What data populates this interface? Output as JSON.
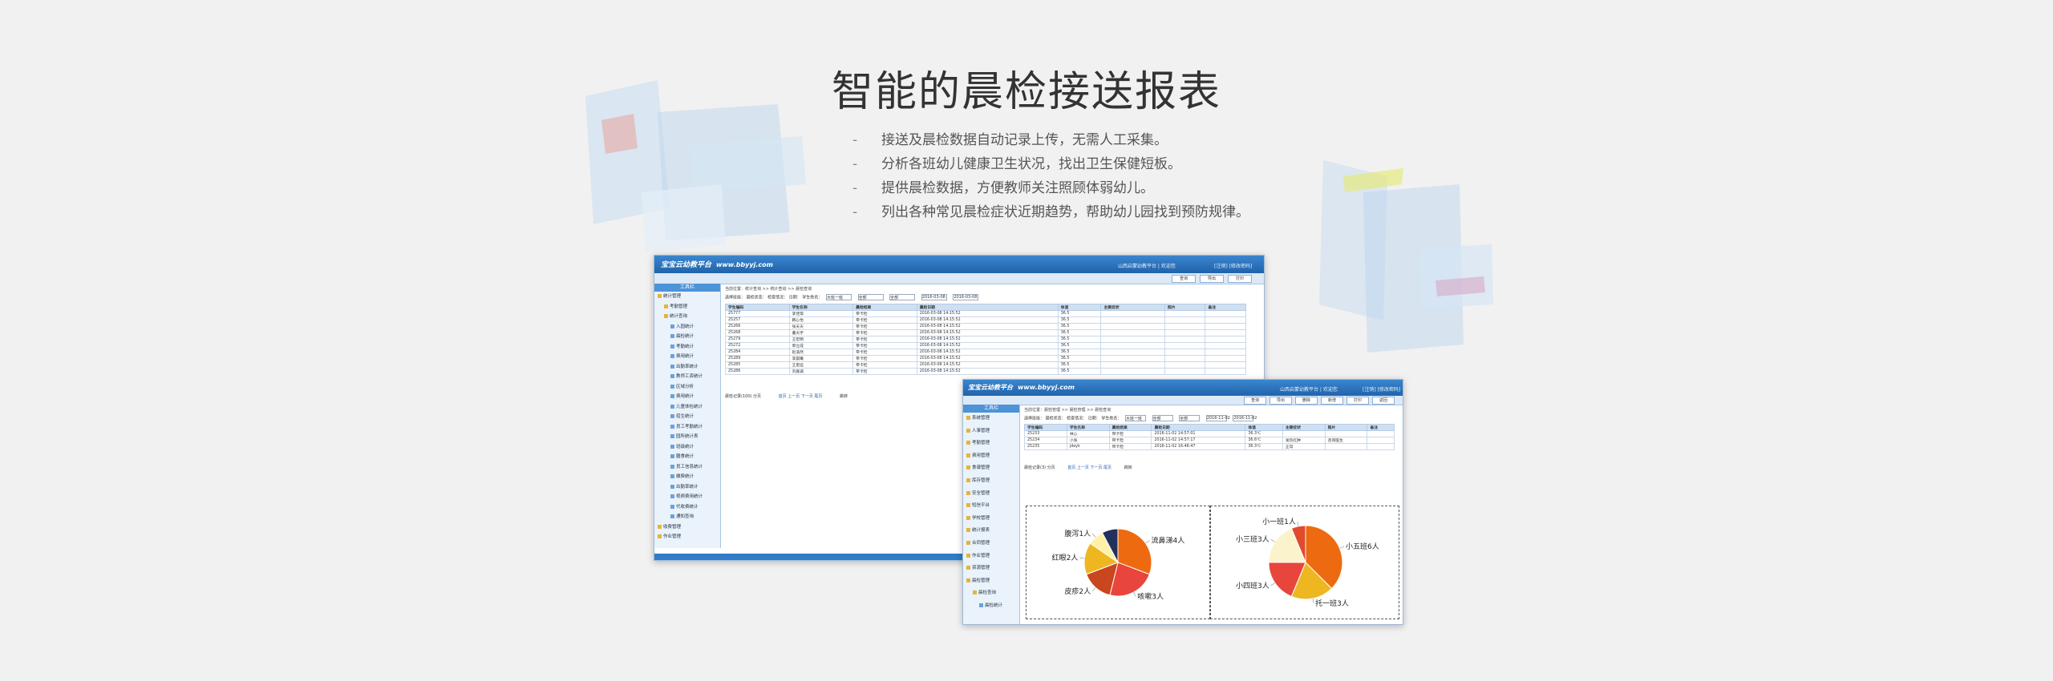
{
  "heading": "智能的晨检接送报表",
  "bullets": [
    "接送及晨检数据自动记录上传，无需人工采集。",
    "分析各班幼儿健康卫生状况，找出卫生保健短板。",
    "提供晨检数据，方便教师关注照顾体弱幼儿。",
    "列出各种常见晨检症状近期趋势，帮助幼儿园找到预防规律。"
  ],
  "bullet_dash": "-",
  "win1": {
    "logo": "宝宝云幼教平台",
    "logo_url": "www.bbyyj.com",
    "header_info": "山西启蒙幼教平台 | 欢迎您",
    "header_links": "[注销] [修改密码]",
    "toolbar": [
      "查询",
      "导出",
      "打印"
    ],
    "sidebar_title": "工具栏",
    "sidebar": [
      {
        "label": "统计管理",
        "folder": true,
        "indent": 0
      },
      {
        "label": "考勤管理",
        "folder": true,
        "indent": 1
      },
      {
        "label": "统计查询",
        "folder": true,
        "indent": 1
      },
      {
        "label": "入园统计",
        "indent": 2
      },
      {
        "label": "晨检统计",
        "indent": 2
      },
      {
        "label": "考勤统计",
        "indent": 2
      },
      {
        "label": "费用统计",
        "indent": 2
      },
      {
        "label": "出勤率统计",
        "indent": 2
      },
      {
        "label": "教师工资统计",
        "indent": 2
      },
      {
        "label": "区域分析",
        "indent": 2
      },
      {
        "label": "费用统计",
        "indent": 2
      },
      {
        "label": "儿童体检统计",
        "indent": 2
      },
      {
        "label": "招生统计",
        "indent": 2
      },
      {
        "label": "员工考勤统计",
        "indent": 2
      },
      {
        "label": "园所统计表",
        "indent": 2
      },
      {
        "label": "班级统计",
        "indent": 2
      },
      {
        "label": "膳食统计",
        "indent": 2
      },
      {
        "label": "员工信息统计",
        "indent": 2
      },
      {
        "label": "缴费统计",
        "indent": 2
      },
      {
        "label": "出勤率统计",
        "indent": 2
      },
      {
        "label": "视频费用统计",
        "indent": 2
      },
      {
        "label": "代收费统计",
        "indent": 2
      },
      {
        "label": "通知查询",
        "indent": 2
      },
      {
        "label": "收费管理",
        "folder": true,
        "indent": 0
      },
      {
        "label": "作业管理",
        "folder": true,
        "indent": 0
      }
    ],
    "crumb": "当前位置：统计查询 >> 统计查询 >> 晨检查询",
    "filter_text": "选择班级：  晨检状态：  检查情况：  日期：  学生姓名：",
    "filter_values": [
      "大班一班",
      "全部",
      "全部",
      "2016-03-08",
      "2016-03-08"
    ],
    "columns": [
      "学生编码",
      "学生名称",
      "晨检结果",
      "晨检日期",
      "体温",
      "主要症状",
      "照片",
      "备注"
    ],
    "rows": [
      [
        "25777",
        "李佳琪",
        "带卡检",
        "2016-03-08 14:15:52",
        "36.5",
        "",
        "",
        ""
      ],
      [
        "25257",
        "韩心怡",
        "带卡检",
        "2016-03-08 14:15:52",
        "36.5",
        "",
        "",
        ""
      ],
      [
        "25266",
        "张天天",
        "带卡检",
        "2016-03-08 14:15:52",
        "36.5",
        "",
        "",
        ""
      ],
      [
        "25268",
        "董天宇",
        "带卡检",
        "2016-03-08 14:15:52",
        "36.5",
        "",
        "",
        ""
      ],
      [
        "25279",
        "王宏明",
        "带卡检",
        "2016-03-08 14:15:52",
        "36.5",
        "",
        "",
        ""
      ],
      [
        "25272",
        "郭立成",
        "带卡检",
        "2016-03-08 14:15:52",
        "36.5",
        "",
        "",
        ""
      ],
      [
        "25284",
        "赵浩然",
        "带卡检",
        "2016-03-08 14:15:52",
        "36.5",
        "",
        "",
        ""
      ],
      [
        "25289",
        "李晨曦",
        "带卡检",
        "2016-03-08 14:15:52",
        "36.5",
        "",
        "",
        ""
      ],
      [
        "25285",
        "王思远",
        "带卡检",
        "2016-03-08 14:15:52",
        "36.5",
        "",
        "",
        ""
      ],
      [
        "25286",
        "刘嘉诚",
        "带卡检",
        "2016-03-08 14:15:52",
        "36.5",
        "",
        "",
        ""
      ]
    ],
    "pager_left": "晨检记录(100) 分页",
    "pager_mid": "首页 上一页 下一页 尾页",
    "pager_right": "跳转"
  },
  "win2": {
    "logo": "宝宝云幼教平台",
    "logo_url": "www.bbyyj.com",
    "header_info": "山西启蒙幼教平台 | 欢迎您",
    "header_links": "[注销] [修改密码]",
    "toolbar": [
      "查询",
      "导出",
      "删除",
      "新增",
      "打印",
      "返回"
    ],
    "sidebar_title": "工具栏",
    "sidebar": [
      {
        "label": "系统管理",
        "folder": true,
        "indent": 0
      },
      {
        "label": "人事管理",
        "folder": true,
        "indent": 0
      },
      {
        "label": "考勤管理",
        "folder": true,
        "indent": 0
      },
      {
        "label": "费用管理",
        "folder": true,
        "indent": 0
      },
      {
        "label": "食谱管理",
        "folder": true,
        "indent": 0
      },
      {
        "label": "库存管理",
        "folder": true,
        "indent": 0
      },
      {
        "label": "安全管理",
        "folder": true,
        "indent": 0
      },
      {
        "label": "短信平台",
        "folder": true,
        "indent": 0
      },
      {
        "label": "学校管理",
        "folder": true,
        "indent": 0
      },
      {
        "label": "统计报表",
        "folder": true,
        "indent": 0
      },
      {
        "label": "合同管理",
        "folder": true,
        "indent": 0
      },
      {
        "label": "作业管理",
        "folder": true,
        "indent": 0
      },
      {
        "label": "资源管理",
        "folder": true,
        "indent": 0
      },
      {
        "label": "晨检管理",
        "folder": true,
        "indent": 0
      },
      {
        "label": "晨检查询",
        "folder": true,
        "indent": 1
      },
      {
        "label": "晨检统计",
        "indent": 2
      }
    ],
    "crumb": "当前位置：晨检管理 >> 晨检管理 >> 晨检查询",
    "filter_text": "选择班级：  晨检状态：  检查情况：  日期：  学生姓名：",
    "filter_values": [
      "大班一班",
      "全部",
      "全部",
      "2016-11-02",
      "2016-11-02"
    ],
    "columns": [
      "学生编码",
      "学生名称",
      "晨检结果",
      "晨检日期",
      "体温",
      "主要症状",
      "照片",
      "备注"
    ],
    "rows": [
      [
        "25233",
        "林心",
        "带卡检",
        "2016-11-02 14:57:01",
        "36.3℃",
        "",
        "",
        ""
      ],
      [
        "25234",
        "小张",
        "带卡检",
        "2016-11-02 14:57:17",
        "36.6℃",
        "发热红肿",
        "咨询医生",
        ""
      ],
      [
        "25235",
        "jdeyk",
        "带卡检",
        "2016-11-02 16:46:47",
        "36.3℃",
        "正常",
        "",
        ""
      ]
    ],
    "pager_left": "晨检记录(3) 分页",
    "pager_mid": "首页 上一页 下一页 尾页",
    "pager_right": "跳转"
  },
  "chart_data": [
    {
      "type": "pie",
      "title": "",
      "slices": [
        {
          "label": "流鼻涕4人",
          "value": 4,
          "color": "#ee6a10"
        },
        {
          "label": "咳嗽3人",
          "value": 3,
          "color": "#e8453c"
        },
        {
          "label": "皮疹2人",
          "value": 2,
          "color": "#c9461e"
        },
        {
          "label": "红眼2人",
          "value": 2,
          "color": "#eeb722"
        },
        {
          "label": "腹泻1人",
          "value": 1,
          "color": "#fff1a8"
        },
        {
          "label": "",
          "value": 1,
          "color": "#22305c"
        }
      ]
    },
    {
      "type": "pie",
      "title": "",
      "slices": [
        {
          "label": "小五班6人",
          "value": 6,
          "color": "#ee6a10"
        },
        {
          "label": "托一班3人",
          "value": 3,
          "color": "#eeb722"
        },
        {
          "label": "小四班3人",
          "value": 3,
          "color": "#e8453c"
        },
        {
          "label": "小三班3人",
          "value": 3,
          "color": "#fbf3cc"
        },
        {
          "label": "小一班1人",
          "value": 1,
          "color": "#e14a2c"
        }
      ]
    }
  ]
}
